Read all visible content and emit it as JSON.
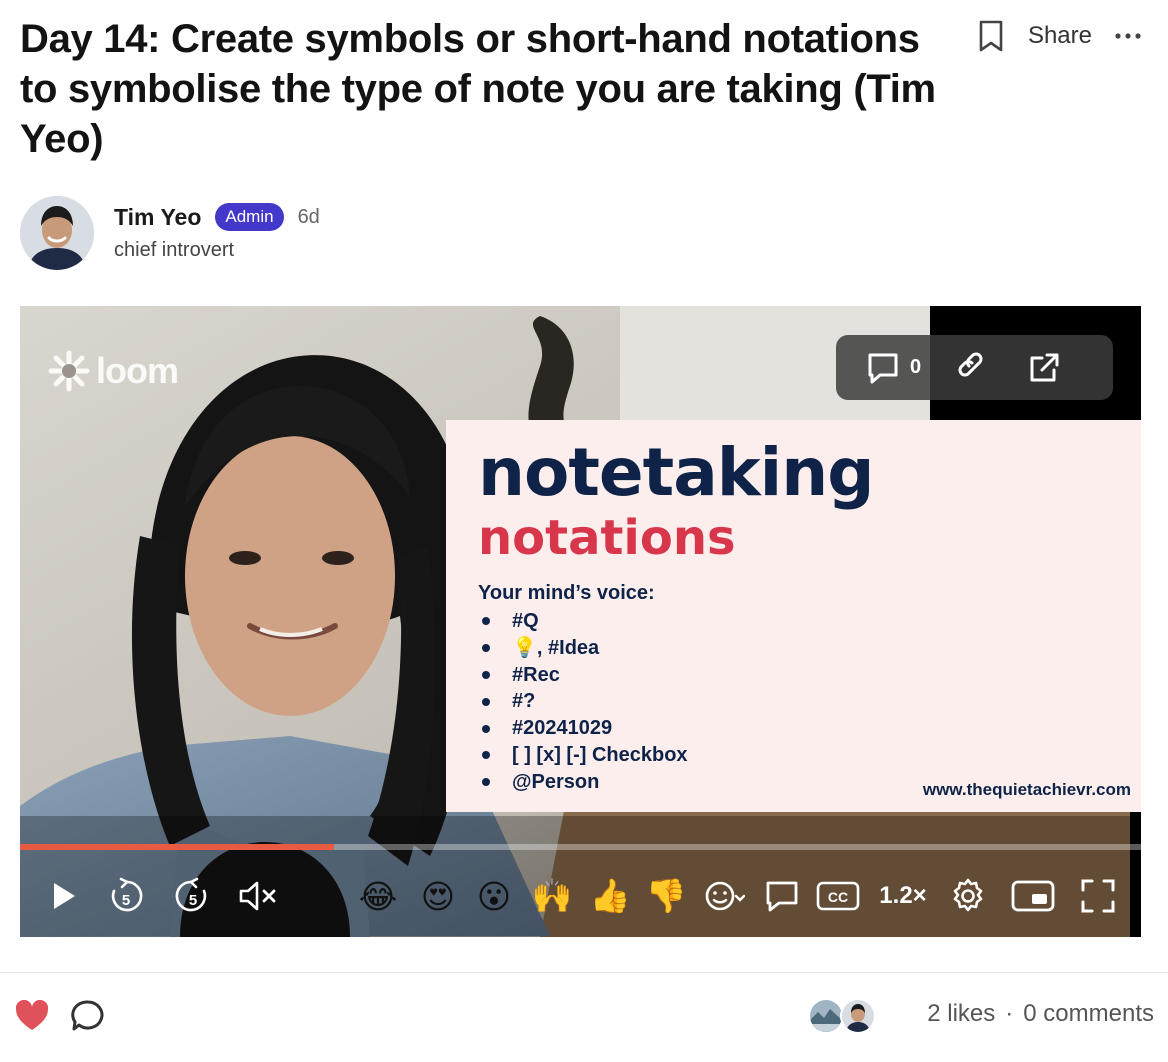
{
  "post": {
    "title": "Day 14: Create symbols or short-hand notations to symbolise the type of note you are taking (Tim Yeo)",
    "share_label": "Share",
    "bookmark_icon": "bookmark-icon",
    "more_icon": "more-horizontal-icon"
  },
  "author": {
    "name": "Tim Yeo",
    "badge": "Admin",
    "age": "6d",
    "tagline": "chief introvert"
  },
  "video": {
    "loom_label": "loom",
    "comment_count": "0",
    "progress": 0.28,
    "speed_label": "1.2×",
    "emoji_reactions": [
      "😂",
      "😍",
      "😮",
      "🙌",
      "👍",
      "👎"
    ],
    "slide": {
      "title": "notetaking",
      "subtitle": "notations",
      "section": "Your mind’s voice:",
      "items": [
        "#Q",
        "💡, #Idea",
        "#Rec",
        "#?",
        "#20241029",
        "[ ] [x] [-] Checkbox",
        "@Person"
      ],
      "url": "www.thequietachievr.com"
    }
  },
  "footer": {
    "likes": "2 likes",
    "separator": "·",
    "comments": "0 comments"
  },
  "colors": {
    "badge": "#4338ca",
    "progress": "#e85a41",
    "heart": "#e0525a",
    "slide_navy": "#0f2348",
    "slide_red": "#d8364a"
  }
}
